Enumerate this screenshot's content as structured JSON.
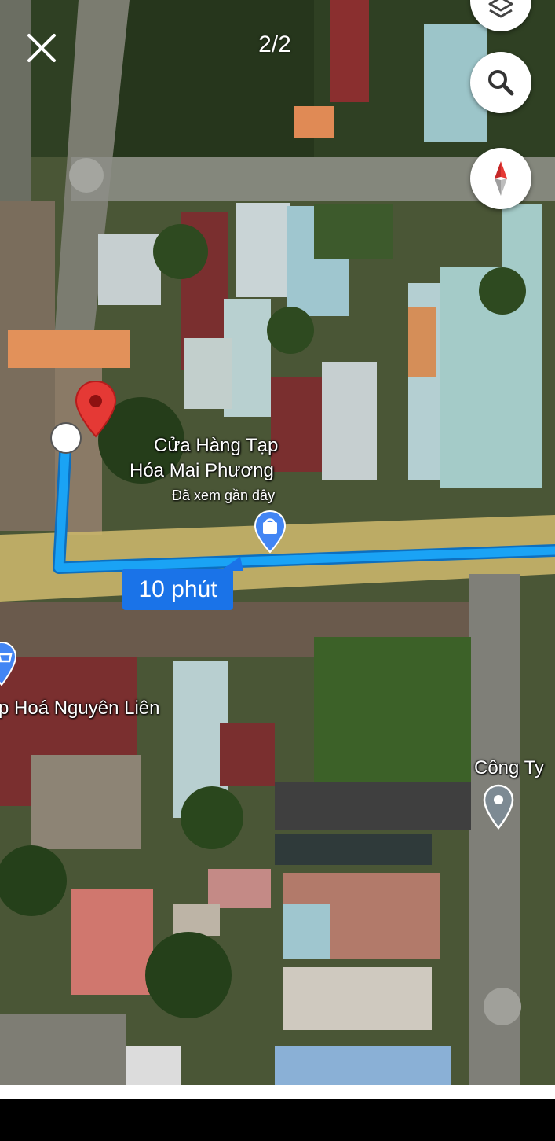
{
  "viewer": {
    "counter": "2/2"
  },
  "route": {
    "duration_label": "10 phút",
    "color": "#1aa3f5"
  },
  "places": {
    "destination": {
      "name_line1": "Cửa Hàng Tạp",
      "name_line2": "Hóa Mai Phương",
      "status": "Đã xem gần đây",
      "icon": "shopping-bag-icon"
    },
    "store_left": {
      "name": "p Hoá Nguyên Liên",
      "icon": "shopping-cart-icon"
    },
    "company": {
      "name": "Công Ty",
      "icon": "map-pin-icon"
    }
  },
  "controls": {
    "layers": "layers-icon",
    "search": "search-icon",
    "compass": "compass-icon",
    "close": "close-icon"
  },
  "colors": {
    "marker_red": "#e53935",
    "badge_blue": "#1a73e8",
    "road_yellow": "#c9b56a"
  }
}
